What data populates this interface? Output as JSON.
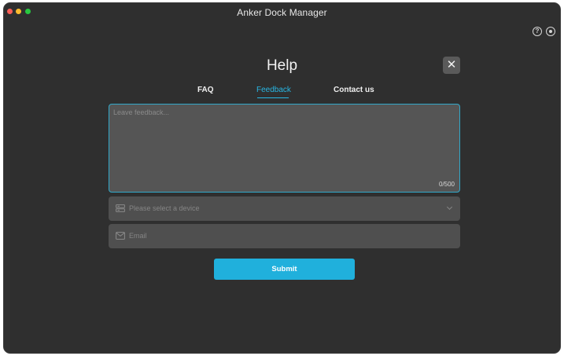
{
  "window": {
    "title": "Anker Dock Manager"
  },
  "toolbar": {
    "help_icon": "help-circle-icon",
    "settings_icon": "settings-icon"
  },
  "panel": {
    "title": "Help",
    "close_icon": "close-icon",
    "close_glyph": "✕",
    "tabs": [
      {
        "label": "FAQ",
        "active": false
      },
      {
        "label": "Feedback",
        "active": true
      },
      {
        "label": "Contact us",
        "active": false
      }
    ]
  },
  "form": {
    "feedback": {
      "placeholder": "Leave feedback...",
      "value": "",
      "char_count": "0/500"
    },
    "device": {
      "placeholder": "Please select a device",
      "icon": "device-icon"
    },
    "email": {
      "placeholder": "Email",
      "value": "",
      "icon": "mail-icon"
    },
    "submit_label": "Submit"
  },
  "colors": {
    "background": "#2f2f2f",
    "accent": "#20b0dc",
    "input_bg": "#4f4f4f",
    "traffic_red": "#fe5f57",
    "traffic_yellow": "#febc2e",
    "traffic_green": "#28c840"
  }
}
